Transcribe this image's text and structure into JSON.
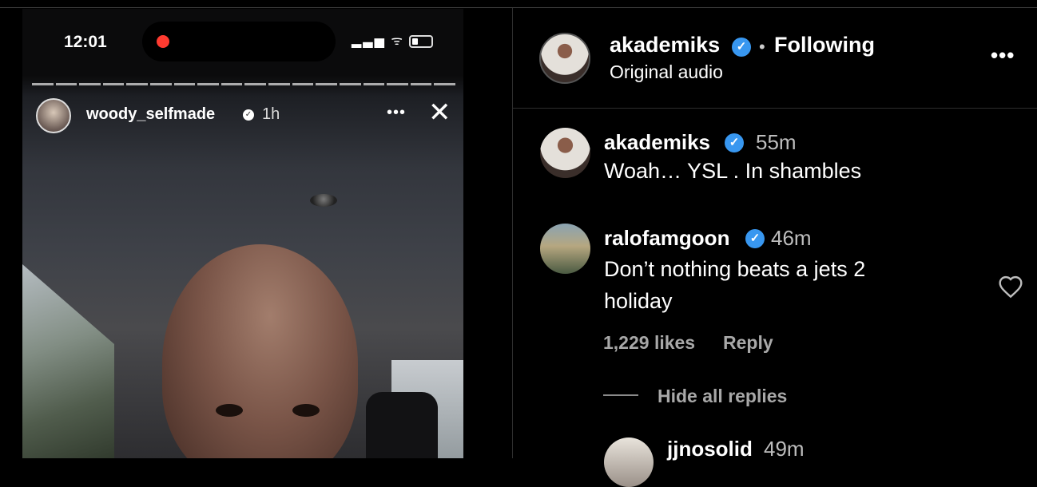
{
  "story": {
    "status_time": "12:01",
    "status_icons": "▂▃▅ ᯤ",
    "username": "woody_selfmade",
    "verified_mark": "✓",
    "time_ago": "1h",
    "more": "•••",
    "close": "✕"
  },
  "post_header": {
    "username": "akademiks",
    "verified_mark": "✓",
    "separator": "•",
    "follow_status": "Following",
    "audio": "Original audio",
    "more": "•••"
  },
  "comments": [
    {
      "username": "akademiks",
      "time": "55m",
      "text": "Woah… YSL . In shambles"
    },
    {
      "username": "ralofamgoon",
      "time": "46m",
      "text_line1": "Don’t nothing beats a jets 2",
      "text_line2": "holiday",
      "likes": "1,229 likes",
      "reply": "Reply",
      "hide_replies": "Hide all replies"
    },
    {
      "username": "jjnosolid",
      "time": "49m"
    }
  ],
  "colors": {
    "verified": "#3897f0",
    "record_dot": "#ff3b30",
    "background": "#000000"
  }
}
